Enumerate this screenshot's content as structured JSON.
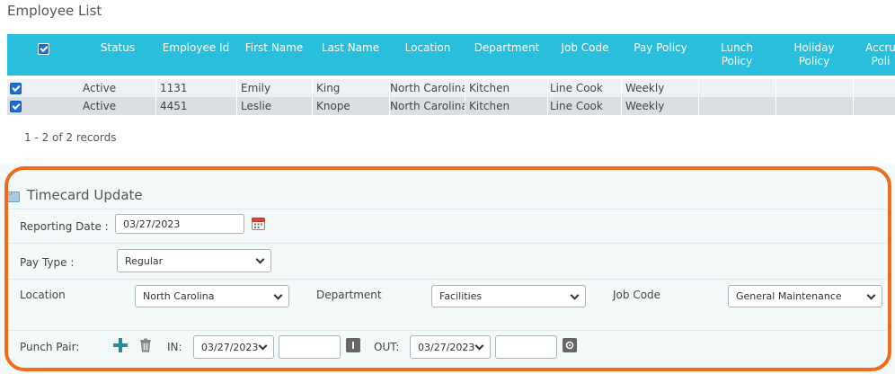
{
  "employee_list": {
    "title": "Employee List",
    "columns": [
      "Status",
      "Employee Id",
      "First Name",
      "Last Name",
      "Location",
      "Department",
      "Job Code",
      "Pay Policy",
      "Lunch Policy",
      "Holiday Policy",
      "Accrual Policy"
    ],
    "columns_display": {
      "lunch": [
        "Lunch",
        "Policy"
      ],
      "holiday": [
        "Holiday",
        "Policy"
      ],
      "accrual": [
        "Accru",
        "Poli"
      ]
    },
    "rows": [
      {
        "status": "Active",
        "id": "1131",
        "first": "Emily",
        "last": "King",
        "location": "North Carolina",
        "department": "Kitchen",
        "job": "Line Cook",
        "pay": "Weekly"
      },
      {
        "status": "Active",
        "id": "4451",
        "first": "Leslie",
        "last": "Knope",
        "location": "North Carolina",
        "department": "Kitchen",
        "job": "Line Cook",
        "pay": "Weekly"
      }
    ],
    "records": "1 - 2 of 2 records"
  },
  "timecard": {
    "title": "Timecard Update",
    "reporting_date_label": "Reporting Date :",
    "reporting_date": "03/27/2023",
    "pay_type_label": "Pay Type :",
    "pay_type": "Regular",
    "location_label": "Location",
    "location": "North Carolina",
    "department_label": "Department",
    "department": "Facilities",
    "job_code_label": "Job Code",
    "job_code": "General Maintenance",
    "punch_pair_label": "Punch Pair:",
    "in_label": "IN:",
    "in_date": "03/27/2023",
    "in_time": "",
    "out_label": "OUT:",
    "out_date": "03/27/2023",
    "out_time": ""
  },
  "colors": {
    "header": "#29bedc",
    "highlight": "#f26a1b",
    "add": "#2a8a96"
  }
}
